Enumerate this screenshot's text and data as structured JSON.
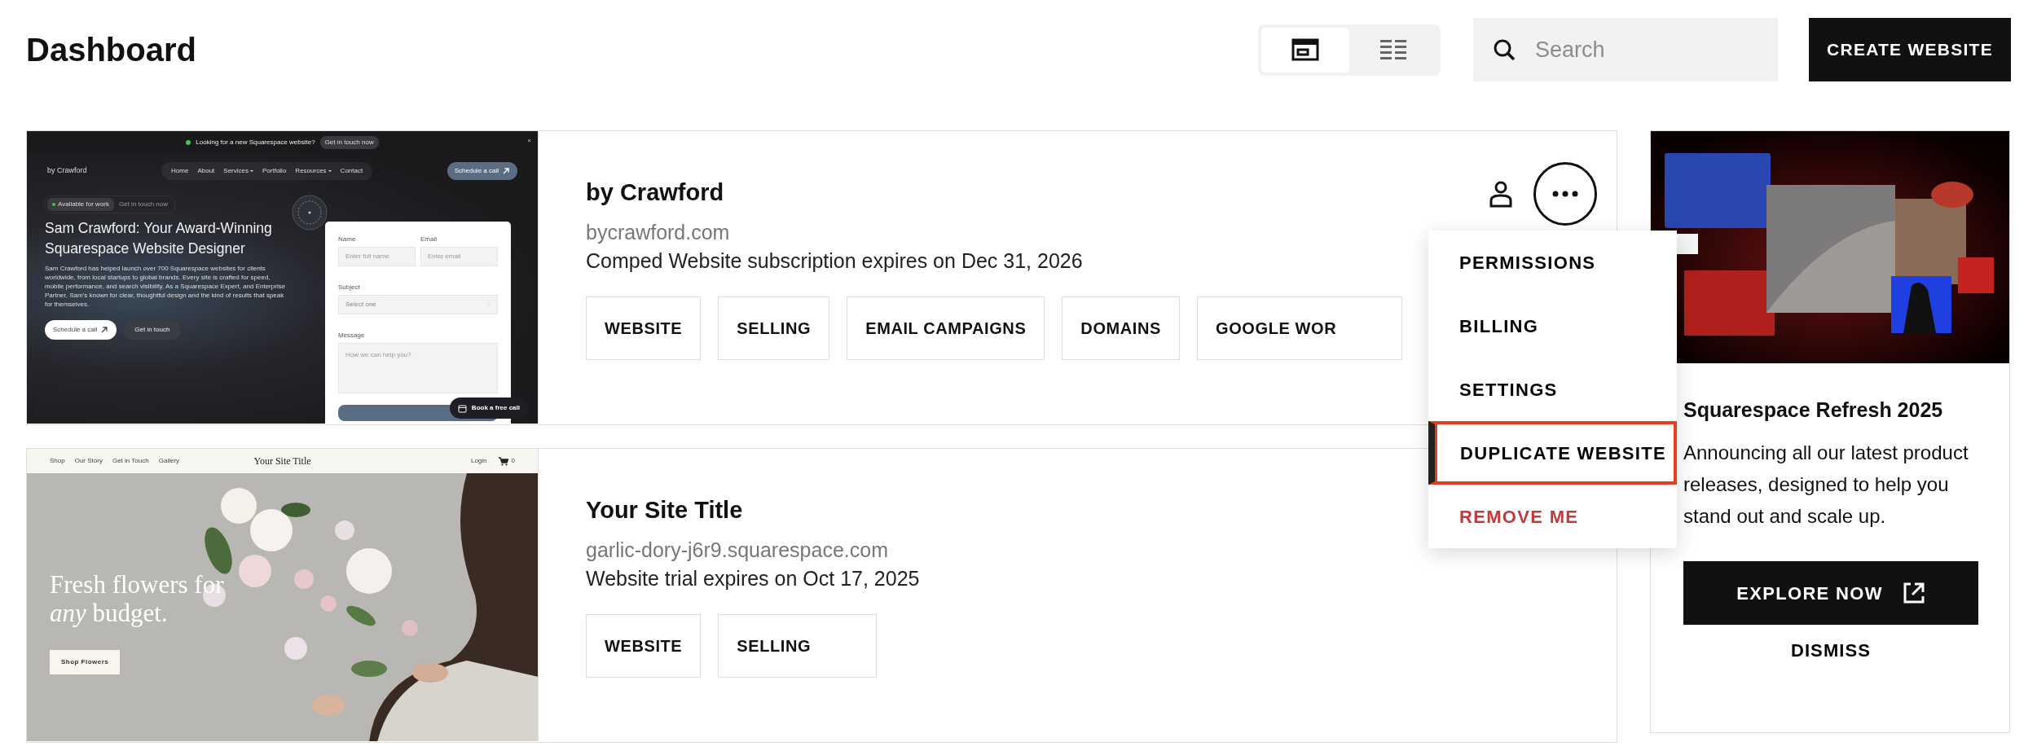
{
  "header": {
    "title": "Dashboard",
    "view_toggle": [
      {
        "kind": "cards",
        "selected": true
      },
      {
        "kind": "list",
        "selected": false
      }
    ],
    "search": {
      "placeholder": "Search"
    },
    "create_button": "CREATE WEBSITE"
  },
  "sites": [
    {
      "preview": {
        "kind": "portfolio",
        "banner": {
          "text": "Looking for a new Squarespace website?",
          "button": "Get in touch now",
          "close": "×"
        },
        "logo": "by Crawford",
        "nav": [
          {
            "label": "Home",
            "has_menu": false
          },
          {
            "label": "About",
            "has_menu": false
          },
          {
            "label": "Services",
            "has_menu": true
          },
          {
            "label": "Portfolio",
            "has_menu": false
          },
          {
            "label": "Resources",
            "has_menu": true
          },
          {
            "label": "Contact",
            "has_menu": false
          }
        ],
        "nav_button": "Schedule a call",
        "status": [
          "Available for work",
          "Get in touch now"
        ],
        "heading": "Sam Crawford: Your Award-Winning Squarespace Website Designer",
        "text": "Sam Crawford has helped launch over 700 Squarespace websites for clients worldwide, from local startups to global brands. Every site is crafted for speed, mobile performance, and search visibility. As a Squarespace Expert, and Enterprise Partner, Sam's known for clear, thoughtful design and the kind of results that speak for themselves.",
        "buttons": [
          "Schedule a call",
          "Get in touch"
        ],
        "form": {
          "fields": [
            {
              "label": "Name",
              "placeholder": "Enter full name"
            },
            {
              "label": "Email",
              "placeholder": "Enter email"
            }
          ],
          "subject": {
            "label": "Subject",
            "placeholder": "Select one"
          },
          "message": {
            "label": "Message",
            "placeholder": "How we can help you?"
          }
        },
        "float_button": "Book a free call"
      },
      "title": "by Crawford",
      "url": "bycrawford.com",
      "subscription": "Comped Website subscription expires on Dec 31, 2026",
      "buttons": [
        "WEBSITE",
        "SELLING",
        "EMAIL CAMPAIGNS",
        "DOMAINS",
        "GOOGLE WOR"
      ],
      "show_actions": true
    },
    {
      "preview": {
        "kind": "store",
        "nav": [
          "Shop",
          "Our Story",
          "Get in Touch",
          "Gallery"
        ],
        "site_title": "Your Site Title",
        "login": "Login",
        "cart_count": "0",
        "hero": "Fresh flowers for *any* budget.",
        "button": "Shop Flowers"
      },
      "title": "Your Site Title",
      "url": "garlic-dory-j6r9.squarespace.com",
      "subscription": "Website trial expires on Oct 17, 2025",
      "buttons": [
        "WEBSITE",
        "SELLING"
      ],
      "show_actions": false
    }
  ],
  "menu": {
    "items": [
      {
        "label": "PERMISSIONS",
        "kind": "normal",
        "selected": false
      },
      {
        "label": "BILLING",
        "kind": "normal",
        "selected": false
      },
      {
        "label": "SETTINGS",
        "kind": "normal",
        "selected": false
      },
      {
        "label": "DUPLICATE WEBSITE",
        "kind": "normal",
        "selected": true
      },
      {
        "label": "REMOVE ME",
        "kind": "danger",
        "selected": false
      }
    ]
  },
  "promo": {
    "title": "Squarespace Refresh 2025",
    "body": "Announcing all our latest product releases, designed to help you stand out and scale up.",
    "cta": "EXPLORE NOW",
    "dismiss": "DISMISS"
  }
}
